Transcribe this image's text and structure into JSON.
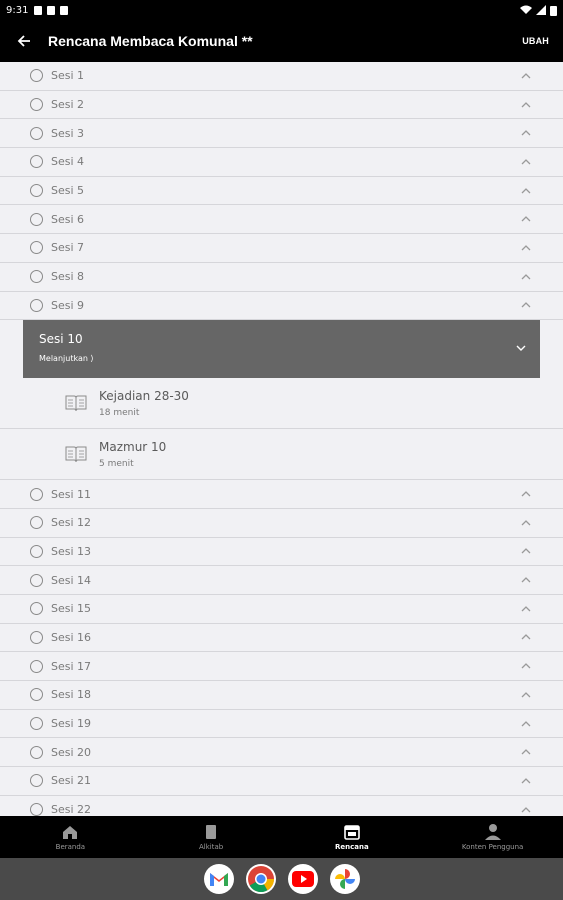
{
  "status": {
    "time": "9:31"
  },
  "app_bar": {
    "title": "Rencana Membaca Komunal **",
    "action": "UBAH"
  },
  "sessions_before": [
    "Sesi 1",
    "Sesi 2",
    "Sesi 3",
    "Sesi 4",
    "Sesi 5",
    "Sesi 6",
    "Sesi 7",
    "Sesi 8",
    "Sesi 9"
  ],
  "expanded": {
    "title": "Sesi 10",
    "subtitle": "Melanjutkan ⟩"
  },
  "readings": [
    {
      "title": "Kejadian 28-30",
      "duration": "18 menit"
    },
    {
      "title": "Mazmur 10",
      "duration": "5 menit"
    }
  ],
  "sessions_after": [
    "Sesi 11",
    "Sesi 12",
    "Sesi 13",
    "Sesi 14",
    "Sesi 15",
    "Sesi 16",
    "Sesi 17",
    "Sesi 18",
    "Sesi 19",
    "Sesi 20",
    "Sesi 21",
    "Sesi 22"
  ],
  "nav": {
    "home": "Beranda",
    "bible": "Alkitab",
    "plans": "Rencana",
    "user": "Konten Pengguna"
  },
  "dock": [
    "gmail-icon",
    "chrome-icon",
    "youtube-icon",
    "photos-icon"
  ]
}
